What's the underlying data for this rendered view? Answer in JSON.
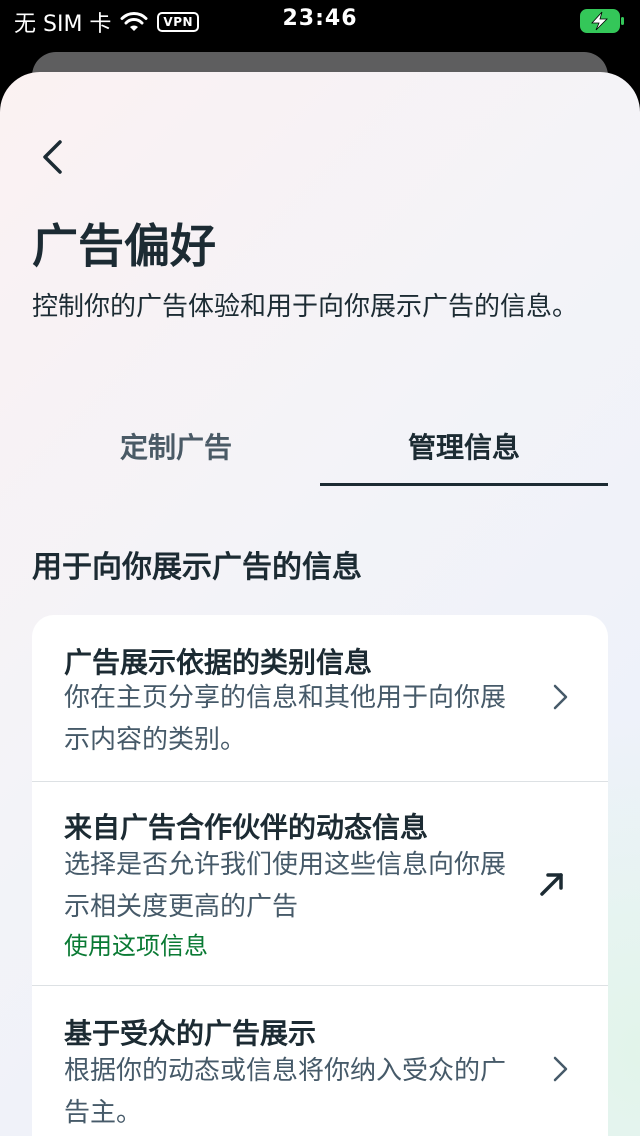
{
  "status_bar": {
    "carrier": "无 SIM 卡",
    "vpn": "VPN",
    "time": "23:46",
    "icons": [
      "wifi-icon",
      "battery-charging-icon"
    ]
  },
  "header": {
    "back_icon": "chevron-left-icon",
    "title": "广告偏好",
    "description": "控制你的广告体验和用于向你展示广告的信息。"
  },
  "tabs": [
    {
      "label": "定制广告",
      "selected": false
    },
    {
      "label": "管理信息",
      "selected": true
    }
  ],
  "section": {
    "title": "用于向你展示广告的信息",
    "items": [
      {
        "title": "广告展示依据的类别信息",
        "subtitle": "你在主页分享的信息和其他用于向你展示内容的类别。",
        "icon": "chevron-right-icon"
      },
      {
        "title": "来自广告合作伙伴的动态信息",
        "subtitle": "选择是否允许我们使用这些信息向你展示相关度更高的广告",
        "link": "使用这项信息",
        "icon": "external-arrow-icon"
      },
      {
        "title": "基于受众的广告展示",
        "subtitle": "根据你的动态或信息将你纳入受众的广告主。",
        "icon": "chevron-right-icon"
      }
    ]
  },
  "colors": {
    "text_primary": "#1c2b33",
    "text_secondary": "#465a69",
    "link_green": "#0a7a34",
    "battery_green": "#34c759"
  }
}
